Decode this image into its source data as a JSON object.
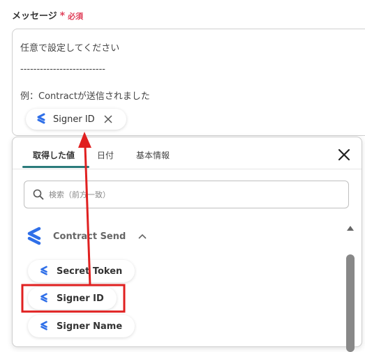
{
  "field": {
    "label": "メッセージ",
    "required_star": "*",
    "required_text": "必須"
  },
  "message": {
    "line1": "任意で設定してください",
    "line2": "--------------------------",
    "line3": "例：Contractが送信されました",
    "chip_label": "Signer ID"
  },
  "popup": {
    "tabs": [
      {
        "label": "取得した値"
      },
      {
        "label": "日付"
      },
      {
        "label": "基本情報"
      }
    ],
    "active_tab": "取得した値",
    "search": {
      "placeholder": "検索（前方一致）"
    },
    "section": {
      "title": "Contract Send"
    },
    "items": [
      {
        "label": "Secret Token"
      },
      {
        "label": "Signer ID"
      },
      {
        "label": "Signer Name"
      }
    ],
    "highlighted_item": "Signer ID"
  },
  "colors": {
    "required": "#e0405a",
    "tab_underline": "#2a7a7a",
    "brand_icon": "#2f6fe8",
    "annotation": "#e02020"
  },
  "icons": [
    "contract-send-icon",
    "close-icon",
    "search-icon",
    "chevron-up-icon",
    "scroll-up-icon"
  ]
}
